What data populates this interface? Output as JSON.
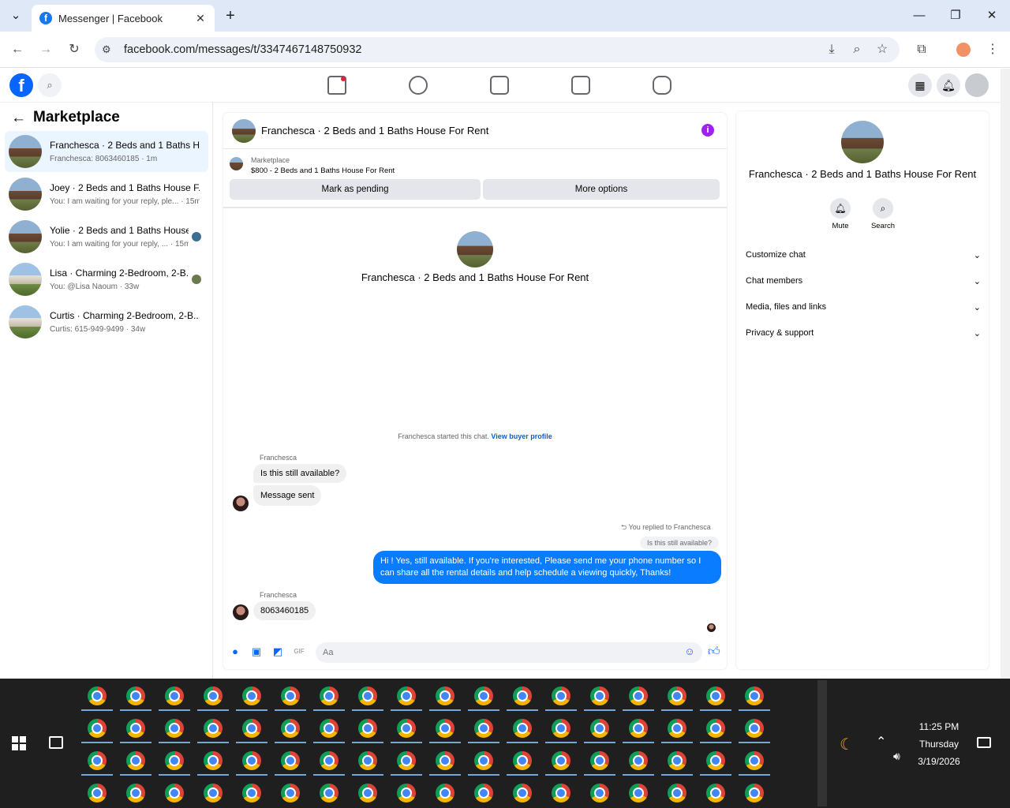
{
  "browser": {
    "tab_title": "Messenger | Facebook",
    "tab_favicon": "f",
    "new_tab": "+",
    "url": "facebook.com/messages/t/3347467148750932",
    "min": "—",
    "max": "❐",
    "close": "✕",
    "back": "←",
    "forward": "→",
    "reload": "↻"
  },
  "fb": {
    "logo": "f",
    "left_title": "Marketplace",
    "conversations": [
      {
        "name": "Franchesca · 2 Beds and 1 Baths H...",
        "sub": "Franchesca: 8063460185 · 1m"
      },
      {
        "name": "Joey · 2 Beds and 1 Baths House F...",
        "sub": "You: I am waiting for your reply, ple... · 15m"
      },
      {
        "name": "Yolie · 2 Beds and 1 Baths House...",
        "sub": "You: I am waiting for your reply, ... · 15m"
      },
      {
        "name": "Lisa · Charming 2-Bedroom, 2-B...",
        "sub": "You: @Lisa Naoum · 33w"
      },
      {
        "name": "Curtis · Charming 2-Bedroom, 2-B...",
        "sub": "Curtis: 615-949-9499 · 34w"
      }
    ]
  },
  "chat": {
    "header_title": "Franchesca · 2 Beds and 1 Baths House For Rent",
    "listing_source": "Marketplace",
    "listing_title": "$800 - 2 Beds and 1 Baths House For Rent",
    "mark_pending": "Mark as pending",
    "more_options": "More options",
    "center_name": "Franchesca · 2 Beds and 1 Baths House For Rent",
    "started": "Franchesca started this chat.",
    "view_profile": "View buyer profile",
    "sender1": "Franchesca",
    "msg1": "Is this still available?",
    "msg2": "Message sent",
    "replied_to": "You replied to Franchesca",
    "quoted": "Is this still available?",
    "outgoing": "Hi ! Yes, still available. If you're interested, Please send me your phone number so I can share all the rental details and help schedule a viewing quickly, Thanks!",
    "sender2": "Franchesca",
    "msg3": "8063460185",
    "composer_placeholder": "Aa"
  },
  "details": {
    "name": "Franchesca · 2 Beds and 1 Baths House For Rent",
    "mute": "Mute",
    "search": "Search",
    "sections": [
      "Customize chat",
      "Chat members",
      "Media, files and links",
      "Privacy & support"
    ]
  },
  "clock": {
    "time": "11:25 PM",
    "day": "Thursday",
    "date": "3/19/2026"
  }
}
